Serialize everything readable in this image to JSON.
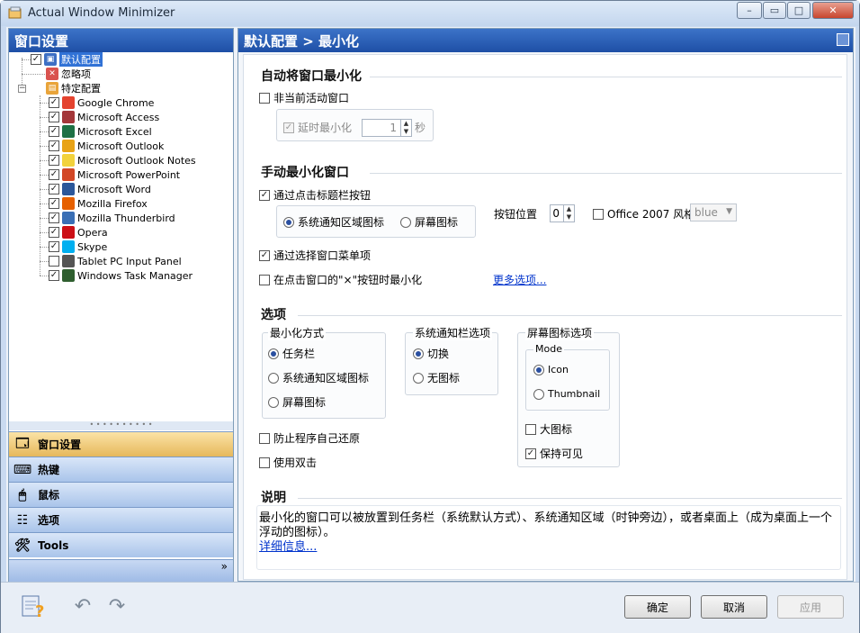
{
  "window": {
    "title": "Actual Window Minimizer",
    "controls": {
      "minimize": "–",
      "restore": "▭",
      "maximize": "□",
      "close": "✕"
    }
  },
  "left": {
    "header": "窗口设置",
    "tree": {
      "default_config": "默认配置",
      "ignore": "忽略项",
      "specific_config": "特定配置",
      "apps": [
        {
          "label": "Google Chrome",
          "checked": true,
          "icon": "chrome-icon",
          "color": "#e4432f"
        },
        {
          "label": "Microsoft Access",
          "checked": true,
          "icon": "access-icon",
          "color": "#a4373a"
        },
        {
          "label": "Microsoft Excel",
          "checked": true,
          "icon": "excel-icon",
          "color": "#1e7145"
        },
        {
          "label": "Microsoft Outlook",
          "checked": true,
          "icon": "outlook-icon",
          "color": "#e8a317"
        },
        {
          "label": "Microsoft Outlook Notes",
          "checked": true,
          "icon": "outlook-notes-icon",
          "color": "#f2d23c"
        },
        {
          "label": "Microsoft PowerPoint",
          "checked": true,
          "icon": "powerpoint-icon",
          "color": "#d24726"
        },
        {
          "label": "Microsoft Word",
          "checked": true,
          "icon": "word-icon",
          "color": "#2b579a"
        },
        {
          "label": "Mozilla Firefox",
          "checked": true,
          "icon": "firefox-icon",
          "color": "#e66000"
        },
        {
          "label": "Mozilla Thunderbird",
          "checked": true,
          "icon": "thunderbird-icon",
          "color": "#3a6fb5"
        },
        {
          "label": "Opera",
          "checked": true,
          "icon": "opera-icon",
          "color": "#cc0f16"
        },
        {
          "label": "Skype",
          "checked": true,
          "icon": "skype-icon",
          "color": "#00aff0"
        },
        {
          "label": "Tablet PC Input Panel",
          "checked": false,
          "icon": "keyboard-icon",
          "color": "#555555"
        },
        {
          "label": "Windows Task Manager",
          "checked": true,
          "icon": "task-manager-icon",
          "color": "#2f5f2f"
        }
      ]
    },
    "nav": {
      "window_settings": "窗口设置",
      "hotkeys": "热键",
      "mouse": "鼠标",
      "options": "选项",
      "tools": "Tools",
      "more": "»"
    }
  },
  "right": {
    "header": "默认配置 > 最小化",
    "auto_section": {
      "title": "自动将窗口最小化",
      "inactive": "非当前活动窗口",
      "delay": "延时最小化",
      "delay_value": "1",
      "seconds": "秒"
    },
    "manual_section": {
      "title": "手动最小化窗口",
      "titlebar_button": "通过点击标题栏按钮",
      "tray_icon": "系统通知区域图标",
      "screen_icon": "屏幕图标",
      "button_position": "按钮位置",
      "button_position_value": "0",
      "office_style": "Office 2007 风格",
      "style_value": "blue",
      "window_menu": "通过选择窗口菜单项",
      "close_button": "在点击窗口的\"×\"按钮时最小化",
      "more_options": "更多选项..."
    },
    "options_section": {
      "title": "选项",
      "minimize_method": {
        "title": "最小化方式",
        "taskbar": "任务栏",
        "tray": "系统通知区域图标",
        "screen": "屏幕图标"
      },
      "tray_options": {
        "title": "系统通知栏选项",
        "toggle": "切换",
        "no_icon": "无图标"
      },
      "screen_icon_options": {
        "title": "屏幕图标选项",
        "mode": "Mode",
        "icon": "Icon",
        "thumbnail": "Thumbnail",
        "large_icon": "大图标",
        "keep_visible": "保持可见"
      },
      "prevent_restore": "防止程序自己还原",
      "double_click": "使用双击"
    },
    "description_section": {
      "title": "说明",
      "text": "最小化的窗口可以被放置到任务栏（系统默认方式）、系统通知区域（时钟旁边），或者桌面上（成为桌面上一个浮动的图标）。",
      "link": "详细信息..."
    }
  },
  "footer": {
    "ok": "确定",
    "cancel": "取消",
    "apply": "应用"
  }
}
